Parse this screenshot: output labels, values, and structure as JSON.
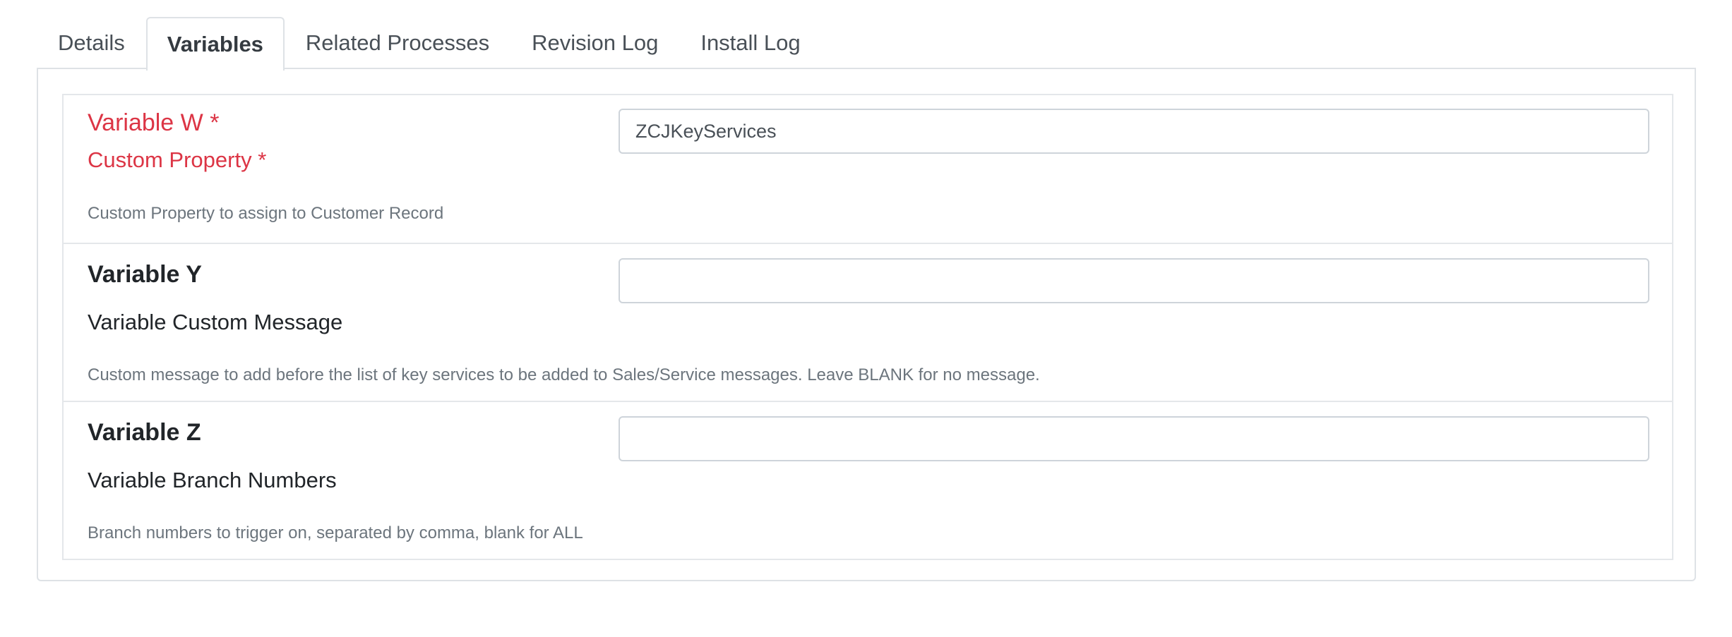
{
  "tabs": [
    {
      "label": "Details",
      "active": false
    },
    {
      "label": "Variables",
      "active": true
    },
    {
      "label": "Related Processes",
      "active": false
    },
    {
      "label": "Revision Log",
      "active": false
    },
    {
      "label": "Install Log",
      "active": false
    }
  ],
  "variables": [
    {
      "title": "Variable W *",
      "subtitle": "Custom Property *",
      "help": "Custom Property to assign to Customer Record",
      "value": "ZCJKeyServices",
      "required": true,
      "color": "#dc3545"
    },
    {
      "title": "Variable Y",
      "subtitle": "Variable Custom Message",
      "help": "Custom message to add before the list of key services to be added to Sales/Service messages. Leave BLANK for no message.",
      "value": "",
      "required": false
    },
    {
      "title": "Variable Z",
      "subtitle": "Variable Branch Numbers",
      "help": "Branch numbers to trigger on, separated by comma, blank for ALL",
      "value": "",
      "required": false
    }
  ]
}
